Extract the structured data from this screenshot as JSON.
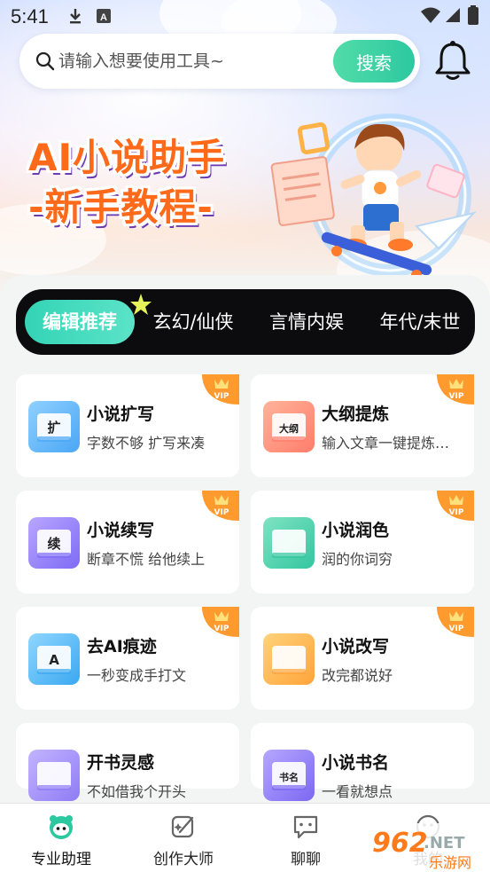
{
  "status_bar": {
    "time": "5:41",
    "icons": [
      "download-icon",
      "app-notification-icon",
      "wifi-icon",
      "signal-icon",
      "battery-icon"
    ]
  },
  "search": {
    "placeholder": "请输入想要使用工具~",
    "button_label": "搜索"
  },
  "banner": {
    "title_line1": "AI小说助手",
    "title_line2": "-新手教程-"
  },
  "tabs": [
    {
      "label": "编辑推荐",
      "active": true
    },
    {
      "label": "玄幻/仙侠",
      "active": false
    },
    {
      "label": "言情内娱",
      "active": false
    },
    {
      "label": "年代/末世",
      "active": false
    }
  ],
  "tools": [
    {
      "title": "小说扩写",
      "desc": "字数不够 扩写来凑",
      "icon": "book-expand-icon",
      "badge": "VIP",
      "icon_char": "扩"
    },
    {
      "title": "大纲提炼",
      "desc": "输入文章一键提炼…",
      "icon": "outline-document-icon",
      "badge": "VIP",
      "icon_char": "大纲"
    },
    {
      "title": "小说续写",
      "desc": "断章不慌 给他续上",
      "icon": "book-continue-icon",
      "badge": "VIP",
      "icon_char": "续"
    },
    {
      "title": "小说润色",
      "desc": "润的你词穷",
      "icon": "book-polish-icon",
      "badge": "VIP",
      "icon_char": ""
    },
    {
      "title": "去AI痕迹",
      "desc": "一秒变成手打文",
      "icon": "de-ai-book-icon",
      "badge": "VIP",
      "icon_char": "A"
    },
    {
      "title": "小说改写",
      "desc": "改完都说好",
      "icon": "rewrite-pencil-icon",
      "badge": "VIP",
      "icon_char": ""
    },
    {
      "title": "开书灵感",
      "desc": "不如借我个开头",
      "icon": "lightbulb-book-icon",
      "badge": "",
      "icon_char": ""
    },
    {
      "title": "小说书名",
      "desc": "一看就想点",
      "icon": "book-title-icon",
      "badge": "",
      "icon_char": "书名"
    }
  ],
  "bottom_nav": [
    {
      "label": "专业助理",
      "icon": "assistant-icon",
      "active": true
    },
    {
      "label": "创作大师",
      "icon": "creator-icon",
      "active": false
    },
    {
      "label": "聊聊",
      "icon": "chat-icon",
      "active": false
    },
    {
      "label": "我的",
      "icon": "profile-icon",
      "active": false
    }
  ],
  "watermark": {
    "brand": "962",
    "sub": "乐游网"
  },
  "colors": {
    "accent": "#2cc8a0",
    "banner_orange": "#ff6a1a",
    "tab_bar": "#0c0c0e",
    "vip_orange": "#ff8a1c"
  }
}
